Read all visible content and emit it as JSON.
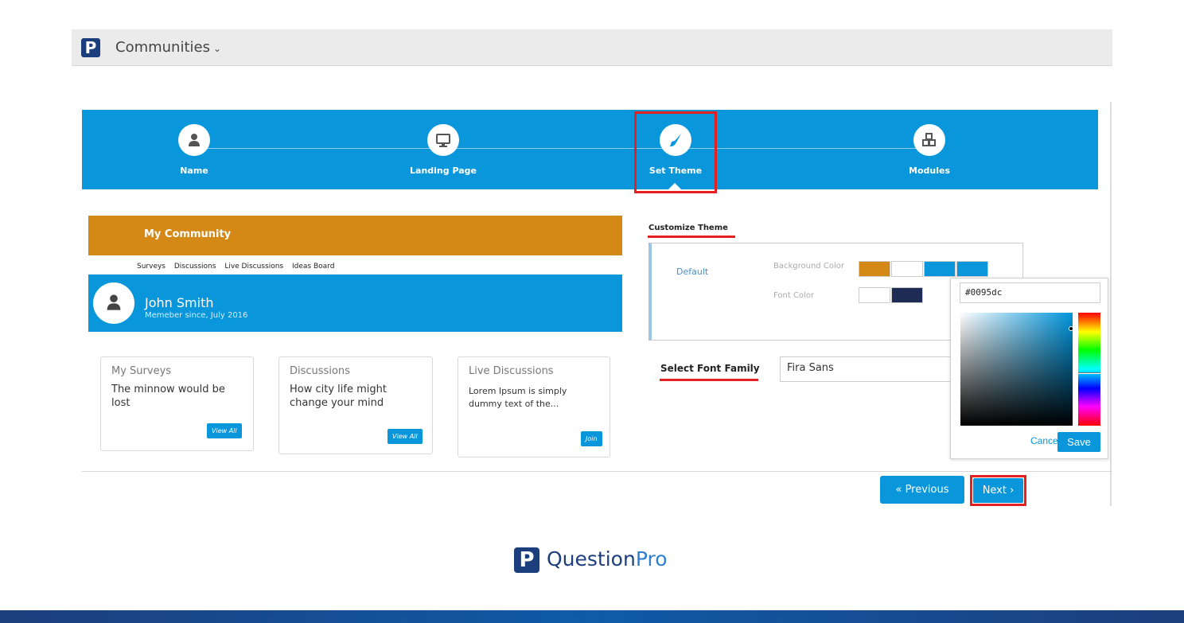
{
  "header": {
    "app_title": "Communities",
    "logo_glyph": "P"
  },
  "wizard": {
    "steps": [
      {
        "label": "Name",
        "icon": "user-icon"
      },
      {
        "label": "Landing Page",
        "icon": "monitor-icon"
      },
      {
        "label": "Set Theme",
        "icon": "paintbrush-icon",
        "active": true
      },
      {
        "label": "Modules",
        "icon": "cubes-icon"
      }
    ]
  },
  "preview": {
    "community_title": "My Community",
    "nav": [
      "Surveys",
      "Discussions",
      "Live Discussions",
      "Ideas Board"
    ],
    "user_name": "John Smith",
    "member_since": "Memeber since, July 2016",
    "cards": [
      {
        "heading": "My Surveys",
        "body": "The minnow would be lost",
        "button": "View All"
      },
      {
        "heading": "Discussions",
        "body": "How city life might change your mind",
        "button": "View All"
      },
      {
        "heading": "Live Discussions",
        "body": "Lorem Ipsum is simply dummy text of the...",
        "button": "Join"
      }
    ]
  },
  "customize": {
    "title": "Customize Theme",
    "theme_name": "Default",
    "background_label": "Background Color",
    "font_label": "Font Color",
    "background_swatches": [
      "#d48815",
      "#ffffff",
      "#0a96db",
      "#0a96db"
    ],
    "font_swatches": [
      "#ffffff",
      "#1d2b55"
    ],
    "font_family_label": "Select Font Family",
    "font_family_value": "Fira Sans"
  },
  "picker": {
    "hex_value": "#0095dc",
    "cancel_label": "Cancel",
    "save_label": "Save"
  },
  "footer_nav": {
    "previous_label": "« Previous",
    "next_label": "Next ›"
  },
  "brand": {
    "question": "Question",
    "pro": "Pro",
    "logo_glyph": "P"
  },
  "colors": {
    "primary": "#0a96db",
    "accent_orange": "#d48815",
    "highlight_red": "#e42020",
    "brand_navy": "#1d3e7c"
  }
}
